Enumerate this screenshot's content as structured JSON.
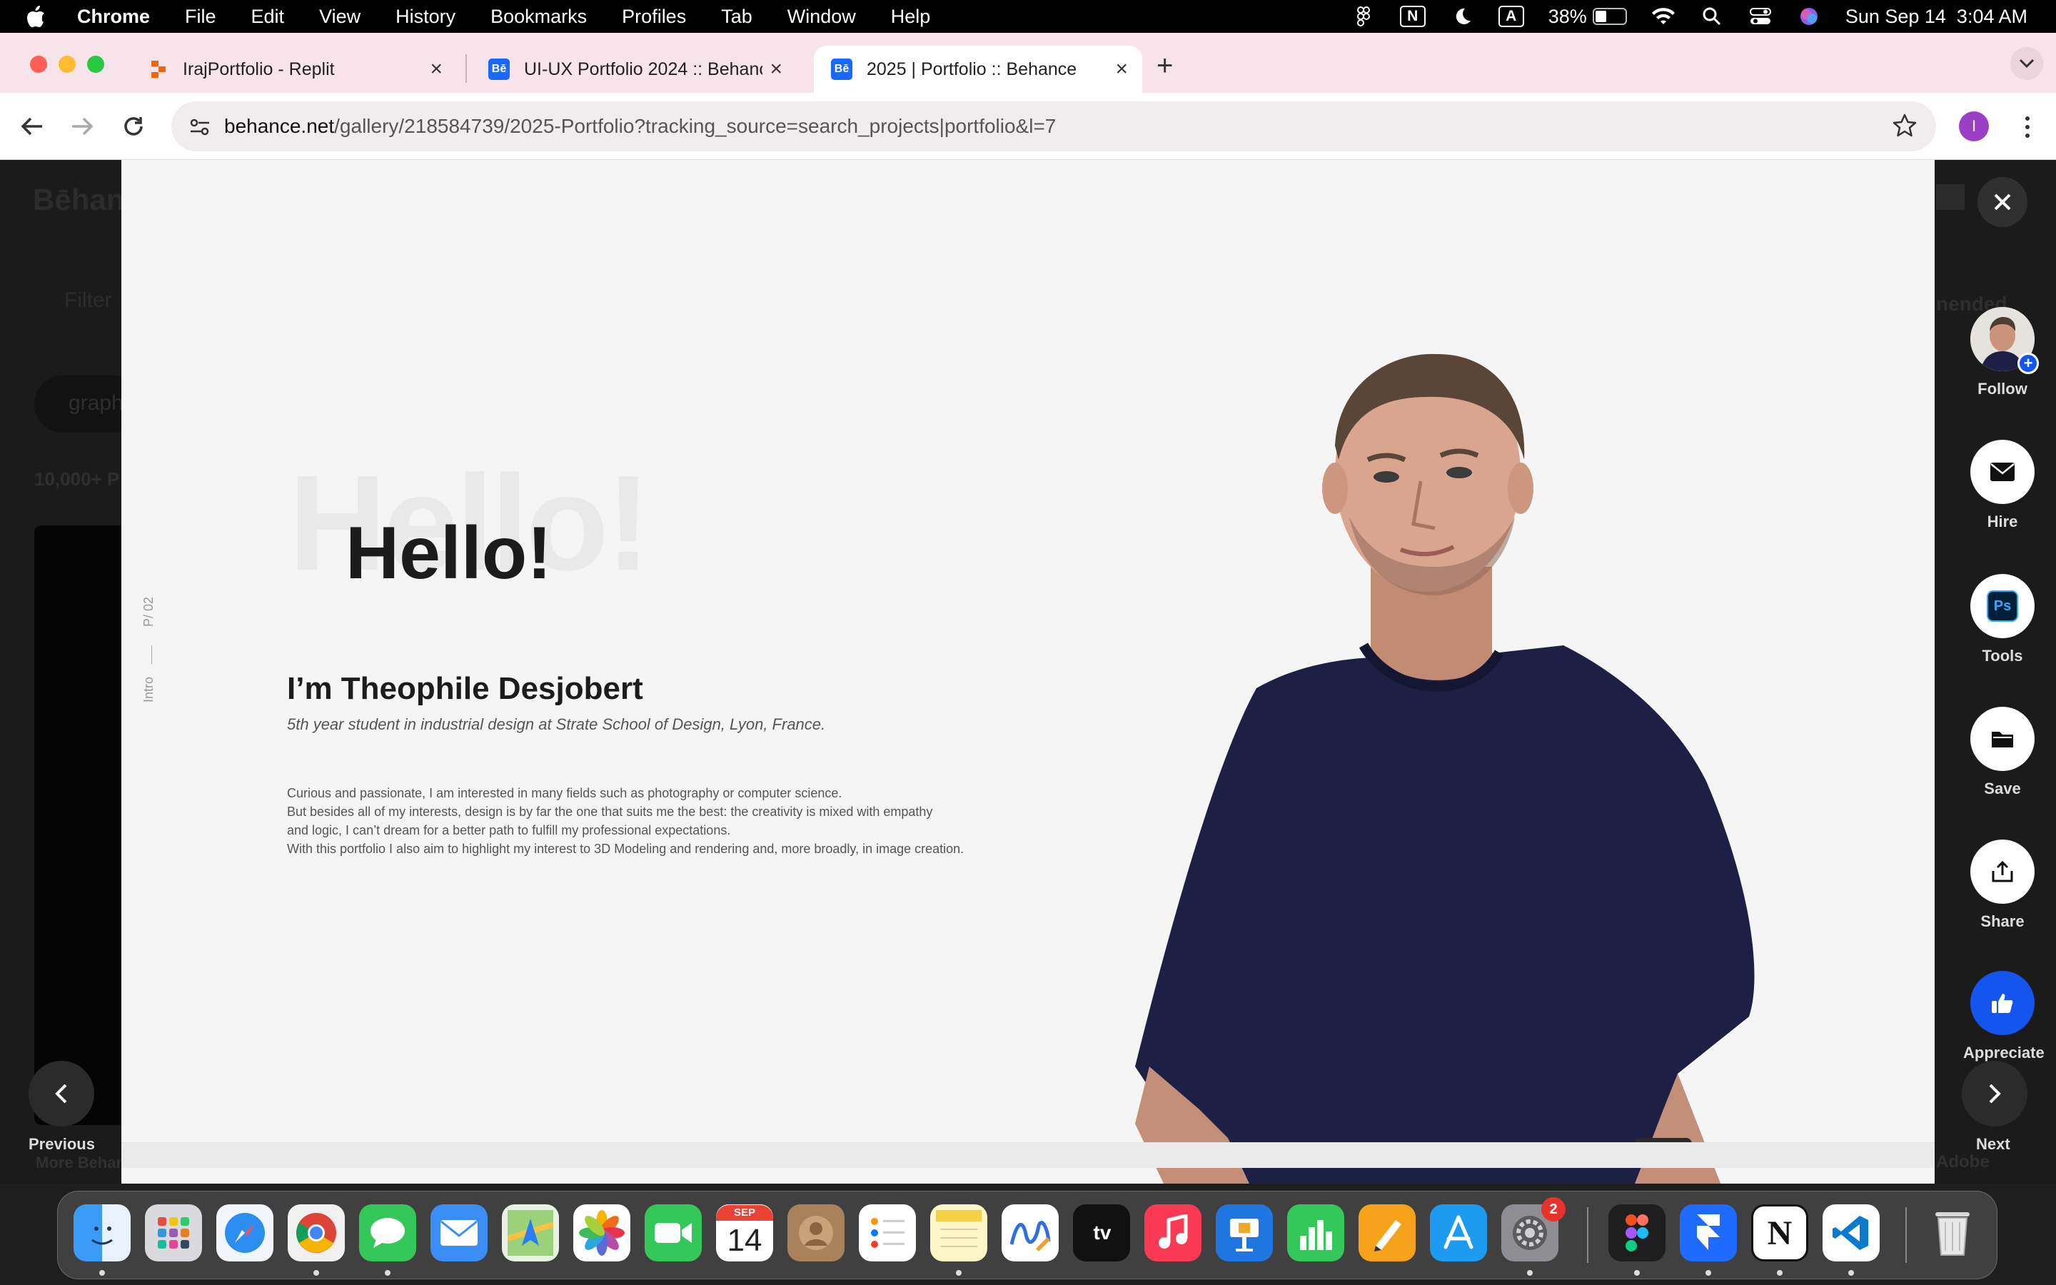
{
  "menubar": {
    "app": "Chrome",
    "items": [
      "File",
      "Edit",
      "View",
      "History",
      "Bookmarks",
      "Profiles",
      "Tab",
      "Window",
      "Help"
    ],
    "battery_percent": "38%",
    "battery_level": 0.38,
    "clock": "Sun Sep 14  3:04 AM",
    "notion_letter": "N",
    "input_letter": "A"
  },
  "tabs": [
    {
      "title": "IrajPortfolio - Replit",
      "active": false
    },
    {
      "title": "UI-UX Portfolio 2024 :: Behance",
      "active": false
    },
    {
      "title": "2025 | Portfolio :: Behance",
      "active": true
    }
  ],
  "favicon_be": "Bē",
  "toolbar": {
    "url_host": "behance.net",
    "url_path": "/gallery/218584739/2025-Portfolio?tracking_source=search_projects|portfolio&l=7",
    "profile_initial": "I"
  },
  "background": {
    "logo": "Bēhance",
    "filter": "Filter",
    "chip": "graphi",
    "count": "10,000+ P",
    "recommended": "nended",
    "more": "More Behance",
    "adobe": "Adobe"
  },
  "project": {
    "side_page": "P/ 02",
    "side_section": "Intro",
    "hello_ghost": "Hello!",
    "hello": "Hello!",
    "name": "I’m Theophile Desjobert",
    "subtitle": "5th year student in industrial design at Strate School of Design, Lyon, France.",
    "bio": [
      "Curious and passionate, I am interested in many fields such as photography or computer science.",
      "But besides all of my interests, design is by far the one that suits me the best: the creativity is mixed with empathy",
      "and logic, I can’t dream for a better path to fulfill my professional expectations.",
      "With this portfolio I also aim to highlight my interest to 3D Modeling and rendering and, more broadly, in image creation."
    ]
  },
  "rail": {
    "follow": "Follow",
    "hire": "Hire",
    "tools": "Tools",
    "tools_badge": "Ps",
    "save": "Save",
    "share": "Share",
    "appreciate": "Appreciate"
  },
  "pager": {
    "previous": "Previous",
    "next": "Next"
  },
  "dock": {
    "calendar_month": "SEP",
    "calendar_day": "14",
    "settings_badge": "2",
    "tv_label": "tv",
    "notion_label": "N"
  },
  "colors": {
    "behance_blue": "#1769ff",
    "appreciate_blue": "#1455f0",
    "tab_strip": "#f7e3ea",
    "shirt_navy": "#1d1f44"
  }
}
